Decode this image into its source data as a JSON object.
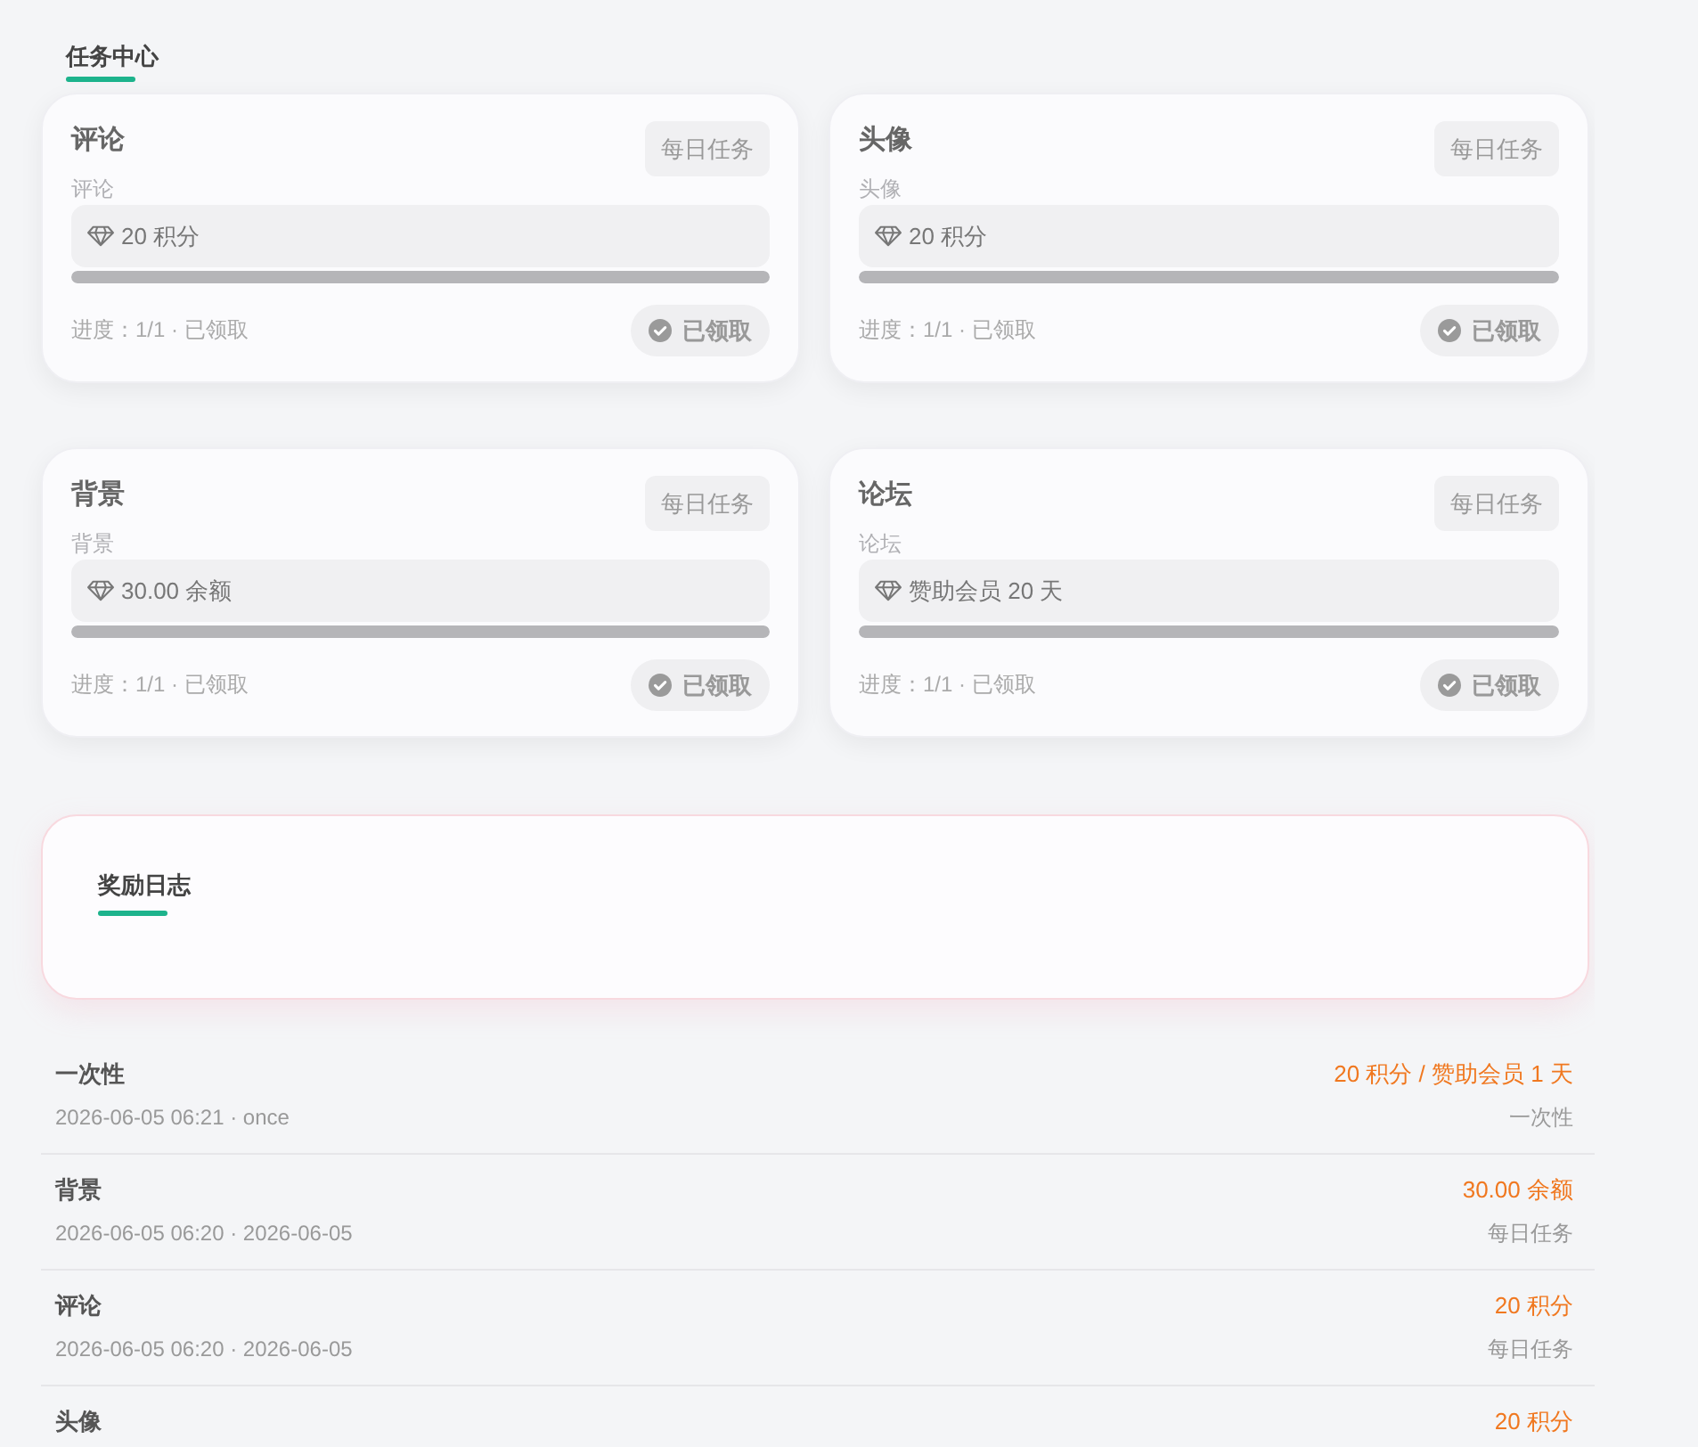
{
  "task_center": {
    "title": "任务中心"
  },
  "tasks": [
    {
      "title": "评论",
      "badge": "每日任务",
      "subtitle": "评论",
      "reward": "20 积分",
      "level": 1,
      "progress": "进度：1/1 · 已领取",
      "button": "已领取",
      "claimed": true
    },
    {
      "title": "头像",
      "badge": "每日任务",
      "subtitle": "头像",
      "reward": "20 积分",
      "level": 1,
      "progress": "进度：1/1 · 已领取",
      "button": "已领取",
      "claimed": true
    },
    {
      "title": "背景",
      "badge": "每日任务",
      "subtitle": "背景",
      "reward": "30.00 余额",
      "level": 1,
      "progress": "进度：1/1 · 已领取",
      "button": "已领取",
      "claimed": true
    },
    {
      "title": "论坛",
      "badge": "每日任务",
      "subtitle": "论坛",
      "reward": "赞助会员 20 天",
      "level": 1,
      "progress": "进度：1/1 · 已领取",
      "button": "已领取",
      "claimed": true
    }
  ],
  "reward_log": {
    "title": "奖励日志"
  },
  "log_entries": [
    {
      "title": "一次性",
      "meta": "2026-06-05 06:21 · once",
      "reward": "20 积分 / 赞助会员 1 天",
      "type": "一次性"
    },
    {
      "title": "背景",
      "meta": "2026-06-05 06:20 · 2026-06-05",
      "reward": "30.00 余额",
      "type": "每日任务"
    },
    {
      "title": "评论",
      "meta": "2026-06-05 06:20 · 2026-06-05",
      "reward": "20 积分",
      "type": "每日任务"
    },
    {
      "title": "头像",
      "reward": "20 积分"
    }
  ]
}
